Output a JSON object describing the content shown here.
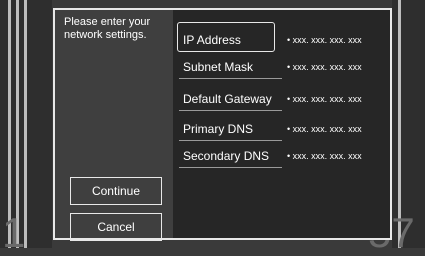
{
  "instructions": "Please enter your network settings.",
  "buttons": {
    "continue": "Continue",
    "cancel": "Cancel"
  },
  "fields": [
    {
      "label": "IP Address",
      "value": "• xxx. xxx. xxx. xxx",
      "selected": true
    },
    {
      "label": "Subnet Mask",
      "value": "• xxx. xxx. xxx. xxx"
    },
    {
      "label": "Default Gateway",
      "value": "• xxx. xxx. xxx. xxx"
    },
    {
      "label": "Primary DNS",
      "value": "• xxx. xxx. xxx. xxx"
    },
    {
      "label": "Secondary DNS",
      "value": "• xxx. xxx. xxx. xxx"
    }
  ],
  "background_numbers": {
    "left": "1",
    "right": "57"
  },
  "colors": {
    "dialog_bg": "#3f3f3f",
    "list_bg": "#262626",
    "border": "#e8e8e8"
  }
}
